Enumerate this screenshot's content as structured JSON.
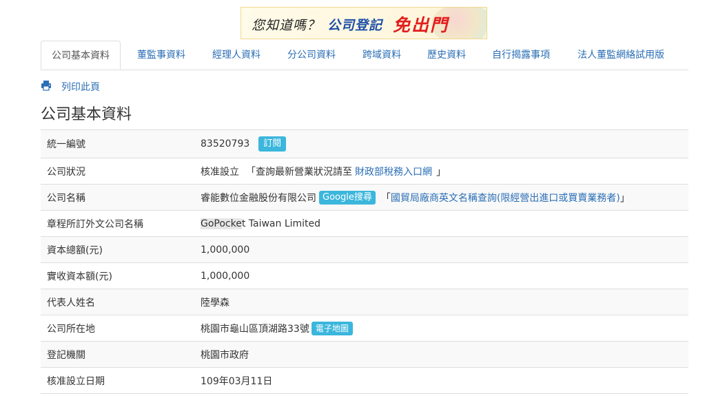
{
  "banner": {
    "question": "您知道嗎？",
    "registration": "公司登記",
    "free": "免出門"
  },
  "tabs": [
    {
      "label": "公司基本資料"
    },
    {
      "label": "董監事資料"
    },
    {
      "label": "經理人資料"
    },
    {
      "label": "分公司資料"
    },
    {
      "label": "跨域資料"
    },
    {
      "label": "歷史資料"
    },
    {
      "label": "自行揭露事項"
    },
    {
      "label": "法人董監網絡試用版"
    }
  ],
  "print": {
    "label": "列印此頁",
    "icon": "printer-icon"
  },
  "page_title": "公司基本資料",
  "rows": {
    "id": {
      "key": "統一編號",
      "value": "83520793",
      "subscribe": "訂閱"
    },
    "status": {
      "key": "公司狀況",
      "value": "核准設立",
      "pre": "「查詢最新營業狀況請至",
      "link": "財政部稅務入口網",
      "post": "」"
    },
    "name": {
      "key": "公司名稱",
      "value": "睿能數位金融股份有限公司",
      "google": "Google搜尋",
      "pre": "「",
      "link": "國貿局廠商英文名稱查詢(限經營出進口或買賣業務者)",
      "post": "」"
    },
    "en_name": {
      "key": "章程所訂外文公司名稱",
      "highlight": "GoPocke",
      "rest": "t Taiwan Limited"
    },
    "capital": {
      "key": "資本總額(元)",
      "value": "1,000,000"
    },
    "paid": {
      "key": "實收資本額(元)",
      "value": "1,000,000"
    },
    "rep": {
      "key": "代表人姓名",
      "value": "陸學森"
    },
    "address": {
      "key": "公司所在地",
      "value": "桃園市龜山區頂湖路33號",
      "map": "電子地圖"
    },
    "authority": {
      "key": "登記機關",
      "value": "桃園市政府"
    },
    "approved": {
      "key": "核准設立日期",
      "value": "109年03月11日"
    }
  },
  "colors": {
    "link": "#2a6eb5",
    "badge": "#3bb6dc",
    "stripe": "#f9f9f9",
    "border": "#dddddd"
  }
}
